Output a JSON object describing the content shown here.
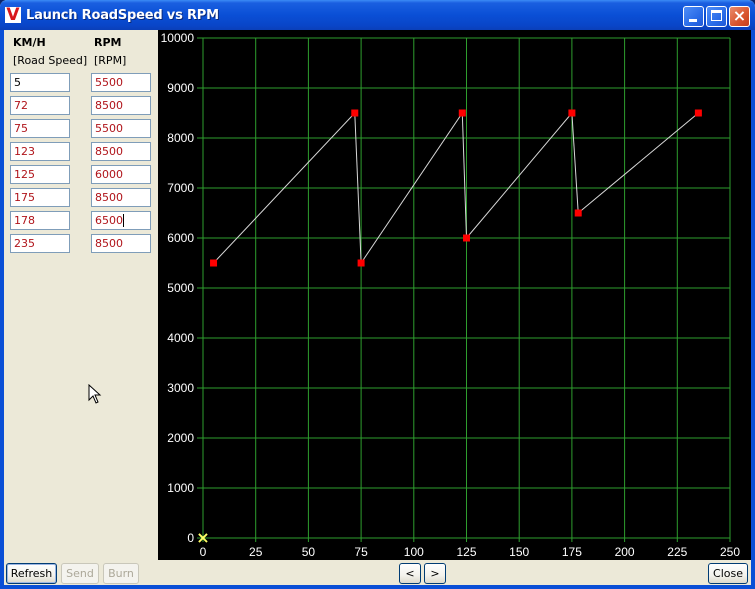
{
  "window": {
    "title": "Launch RoadSpeed vs RPM",
    "app_icon_letter": "V",
    "controls": {
      "minimize": "minimize",
      "maximize": "maximize",
      "close": "×"
    }
  },
  "left_panel": {
    "speed_header": "KM/H",
    "speed_subheader": "[Road Speed]",
    "rpm_header": "RPM",
    "rpm_subheader": "[RPM]",
    "rows": [
      {
        "speed": "5",
        "rpm": "5500"
      },
      {
        "speed": "72",
        "rpm": "8500"
      },
      {
        "speed": "75",
        "rpm": "5500"
      },
      {
        "speed": "123",
        "rpm": "8500"
      },
      {
        "speed": "125",
        "rpm": "6000"
      },
      {
        "speed": "175",
        "rpm": "8500"
      },
      {
        "speed": "178",
        "rpm": "6500"
      },
      {
        "speed": "235",
        "rpm": "8500"
      }
    ]
  },
  "buttons": {
    "refresh": "Refresh",
    "send": "Send",
    "burn": "Burn",
    "prev": "<",
    "next": ">",
    "close": "Close"
  },
  "colors": {
    "plot_bg": "#000000",
    "grid": "#2e9e2e",
    "line": "#d8d8d8",
    "point": "#ff0000",
    "origin_marker": "#ffff66",
    "value_text": "#b0141a"
  },
  "chart_data": {
    "type": "line",
    "title": "Launch RoadSpeed vs RPM",
    "xlabel": "KM/H",
    "ylabel": "RPM",
    "x": [
      5,
      72,
      75,
      123,
      125,
      175,
      178,
      235
    ],
    "series": [
      {
        "name": "RPM",
        "values": [
          5500,
          8500,
          5500,
          8500,
          6000,
          8500,
          6500,
          8500
        ]
      }
    ],
    "xlim": [
      0,
      250
    ],
    "ylim": [
      0,
      10000
    ],
    "x_ticks": [
      "0",
      "25",
      "50",
      "75",
      "100",
      "125",
      "150",
      "175",
      "200",
      "225",
      "250"
    ],
    "y_ticks": [
      "0",
      "1000",
      "2000",
      "3000",
      "4000",
      "5000",
      "6000",
      "7000",
      "8000",
      "9000",
      "10000"
    ],
    "grid": true,
    "origin_marker": "×"
  }
}
